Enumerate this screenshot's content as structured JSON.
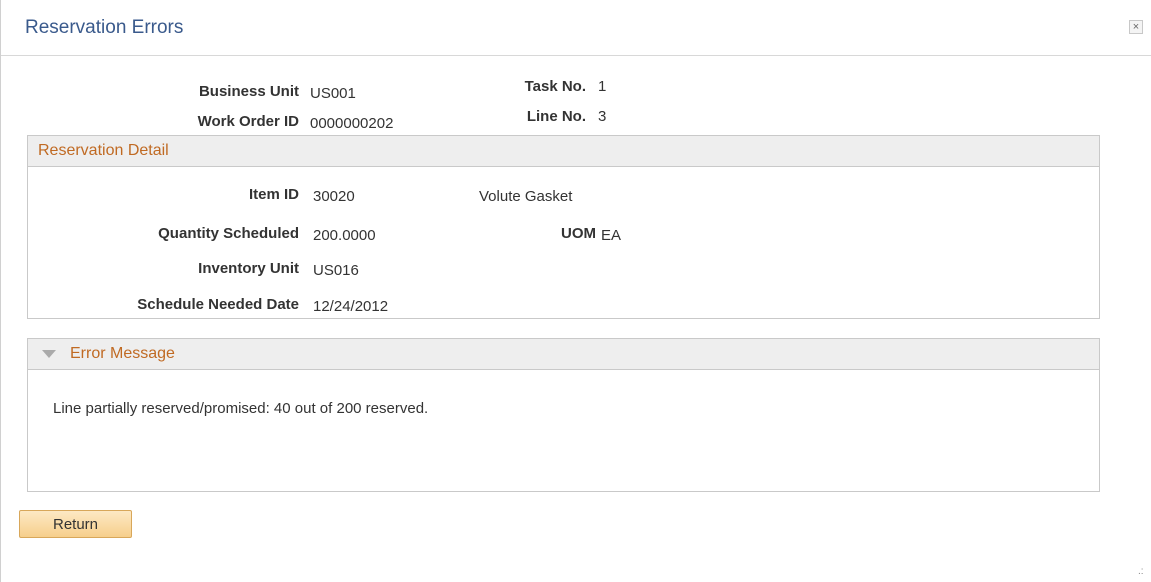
{
  "window": {
    "title": "Reservation Errors",
    "close_label": "×"
  },
  "header": {
    "business_unit_label": "Business Unit",
    "business_unit": "US001",
    "work_order_label": "Work Order ID",
    "work_order": "0000000202",
    "task_no_label": "Task No.",
    "task_no": "1",
    "line_no_label": "Line No.",
    "line_no": "3"
  },
  "reservation_detail": {
    "title": "Reservation Detail",
    "item_id_label": "Item ID",
    "item_id": "30020",
    "item_desc": "Volute Gasket",
    "qty_label": "Quantity Scheduled",
    "qty": "200.0000",
    "uom_label": "UOM",
    "uom": "EA",
    "inv_unit_label": "Inventory Unit",
    "inv_unit": "US016",
    "need_date_label": "Schedule Needed Date",
    "need_date": "12/24/2012"
  },
  "error_message": {
    "title": "Error Message",
    "text": "Line partially reserved/promised: 40 out of 200 reserved."
  },
  "actions": {
    "return_label": "Return"
  },
  "colors": {
    "title": "#3a5a8c",
    "section_title": "#c06a23",
    "button": "#f6cf8c"
  }
}
